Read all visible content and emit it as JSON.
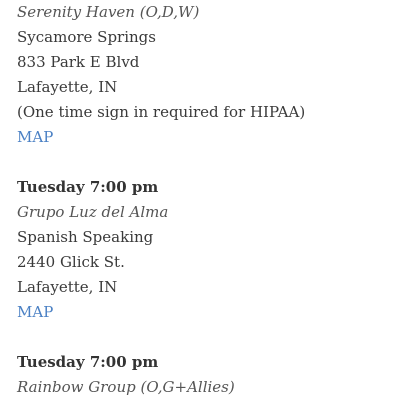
{
  "meetings": [
    {
      "day_time": "",
      "group_name": "Serenity Haven (O,D,W)",
      "lines": [
        "Sycamore Springs",
        "833 Park E Blvd",
        "Lafayette, IN",
        "(One time sign in required for HIPAA)"
      ],
      "map_label": "MAP"
    },
    {
      "day_time": "Tuesday 7:00 pm",
      "group_name": "Grupo Luz del Alma",
      "lines": [
        "Spanish Speaking",
        "2440 Glick St.",
        "Lafayette, IN"
      ],
      "map_label": "MAP"
    },
    {
      "day_time": "Tuesday 7:00 pm",
      "group_name": "Rainbow Group (O,G+Allies)"
    }
  ],
  "colors": {
    "link": "#4a80c4",
    "text": "#3a3a3a"
  }
}
